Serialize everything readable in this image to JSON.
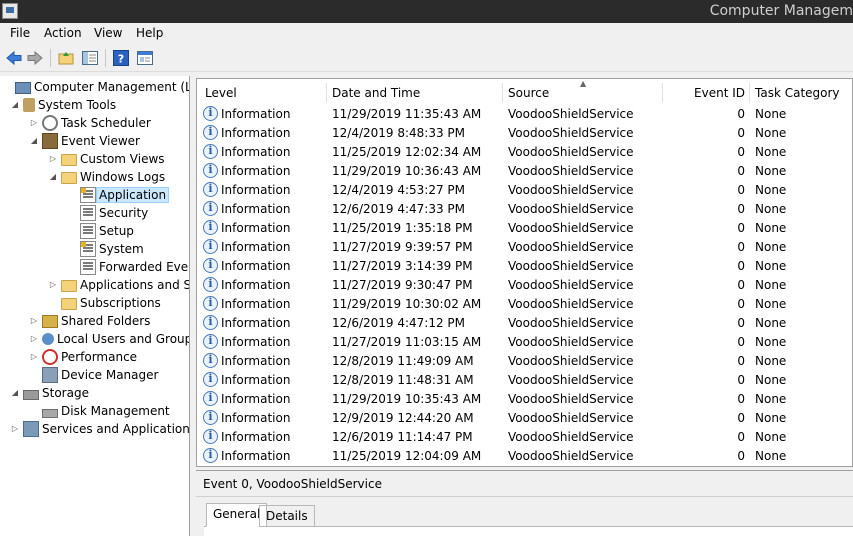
{
  "window": {
    "title": "Computer Managem"
  },
  "menu": [
    {
      "label": "File"
    },
    {
      "label": "Action"
    },
    {
      "label": "View"
    },
    {
      "label": "Help"
    }
  ],
  "toolbar": {
    "buttons": [
      {
        "icon": "back-arrow-icon"
      },
      {
        "icon": "forward-arrow-icon"
      },
      {
        "icon": "up-folder-icon"
      },
      {
        "icon": "show-hide-console-tree-icon"
      },
      {
        "icon": "help-icon"
      },
      {
        "icon": "properties-icon"
      }
    ]
  },
  "tree": [
    {
      "label": "Computer Management (Local",
      "icon": "computer-icon",
      "expand": ""
    },
    {
      "label": "System Tools",
      "icon": "tools-icon",
      "expand": "◢"
    },
    {
      "label": "Task Scheduler",
      "icon": "clock-icon",
      "expand": "▷"
    },
    {
      "label": "Event Viewer",
      "icon": "event-viewer-icon",
      "expand": "◢"
    },
    {
      "label": "Custom Views",
      "icon": "folder-icon",
      "expand": "▷"
    },
    {
      "label": "Windows Logs",
      "icon": "folder-icon",
      "expand": "◢"
    },
    {
      "label": "Application",
      "icon": "application-log-icon",
      "expand": ""
    },
    {
      "label": "Security",
      "icon": "log-icon",
      "expand": ""
    },
    {
      "label": "Setup",
      "icon": "log-icon",
      "expand": ""
    },
    {
      "label": "System",
      "icon": "log-icon",
      "expand": ""
    },
    {
      "label": "Forwarded Event",
      "icon": "log-icon",
      "expand": ""
    },
    {
      "label": "Applications and Se",
      "icon": "folder-icon",
      "expand": "▷"
    },
    {
      "label": "Subscriptions",
      "icon": "folder-icon",
      "expand": ""
    },
    {
      "label": "Shared Folders",
      "icon": "shared-folder-icon",
      "expand": "▷"
    },
    {
      "label": "Local Users and Groups",
      "icon": "users-icon",
      "expand": "▷"
    },
    {
      "label": "Performance",
      "icon": "performance-icon",
      "expand": "▷"
    },
    {
      "label": "Device Manager",
      "icon": "device-manager-icon",
      "expand": ""
    },
    {
      "label": "Storage",
      "icon": "storage-icon",
      "expand": "◢"
    },
    {
      "label": "Disk Management",
      "icon": "disk-icon",
      "expand": ""
    },
    {
      "label": "Services and Applications",
      "icon": "services-icon",
      "expand": "▷"
    }
  ],
  "table": {
    "columns": [
      "Level",
      "Date and Time",
      "Source",
      "Event ID",
      "Task Category"
    ],
    "rows": [
      {
        "level": "Information",
        "datetime": "11/29/2019 11:35:43 AM",
        "source": "VoodooShieldService",
        "event_id": "0",
        "category": "None"
      },
      {
        "level": "Information",
        "datetime": "12/4/2019 8:48:33 PM",
        "source": "VoodooShieldService",
        "event_id": "0",
        "category": "None"
      },
      {
        "level": "Information",
        "datetime": "11/25/2019 12:02:34 AM",
        "source": "VoodooShieldService",
        "event_id": "0",
        "category": "None"
      },
      {
        "level": "Information",
        "datetime": "11/29/2019 10:36:43 AM",
        "source": "VoodooShieldService",
        "event_id": "0",
        "category": "None"
      },
      {
        "level": "Information",
        "datetime": "12/4/2019 4:53:27 PM",
        "source": "VoodooShieldService",
        "event_id": "0",
        "category": "None"
      },
      {
        "level": "Information",
        "datetime": "12/6/2019 4:47:33 PM",
        "source": "VoodooShieldService",
        "event_id": "0",
        "category": "None"
      },
      {
        "level": "Information",
        "datetime": "11/25/2019 1:35:18 PM",
        "source": "VoodooShieldService",
        "event_id": "0",
        "category": "None"
      },
      {
        "level": "Information",
        "datetime": "11/27/2019 9:39:57 PM",
        "source": "VoodooShieldService",
        "event_id": "0",
        "category": "None"
      },
      {
        "level": "Information",
        "datetime": "11/27/2019 3:14:39 PM",
        "source": "VoodooShieldService",
        "event_id": "0",
        "category": "None"
      },
      {
        "level": "Information",
        "datetime": "11/27/2019 9:30:47 PM",
        "source": "VoodooShieldService",
        "event_id": "0",
        "category": "None"
      },
      {
        "level": "Information",
        "datetime": "11/29/2019 10:30:02 AM",
        "source": "VoodooShieldService",
        "event_id": "0",
        "category": "None"
      },
      {
        "level": "Information",
        "datetime": "12/6/2019 4:47:12 PM",
        "source": "VoodooShieldService",
        "event_id": "0",
        "category": "None"
      },
      {
        "level": "Information",
        "datetime": "11/27/2019 11:03:15 AM",
        "source": "VoodooShieldService",
        "event_id": "0",
        "category": "None"
      },
      {
        "level": "Information",
        "datetime": "12/8/2019 11:49:09 AM",
        "source": "VoodooShieldService",
        "event_id": "0",
        "category": "None"
      },
      {
        "level": "Information",
        "datetime": "12/8/2019 11:48:31 AM",
        "source": "VoodooShieldService",
        "event_id": "0",
        "category": "None"
      },
      {
        "level": "Information",
        "datetime": "11/29/2019 10:35:43 AM",
        "source": "VoodooShieldService",
        "event_id": "0",
        "category": "None"
      },
      {
        "level": "Information",
        "datetime": "12/9/2019 12:44:20 AM",
        "source": "VoodooShieldService",
        "event_id": "0",
        "category": "None"
      },
      {
        "level": "Information",
        "datetime": "12/6/2019 11:14:47 PM",
        "source": "VoodooShieldService",
        "event_id": "0",
        "category": "None"
      },
      {
        "level": "Information",
        "datetime": "11/25/2019 12:04:09 AM",
        "source": "VoodooShieldService",
        "event_id": "0",
        "category": "None"
      }
    ]
  },
  "detail": {
    "title": "Event 0, VoodooShieldService",
    "tabs": [
      {
        "label": "General"
      },
      {
        "label": "Details"
      }
    ]
  },
  "colors": {
    "selection": "#cce8ff",
    "title_bar": "#2b2b2b"
  }
}
